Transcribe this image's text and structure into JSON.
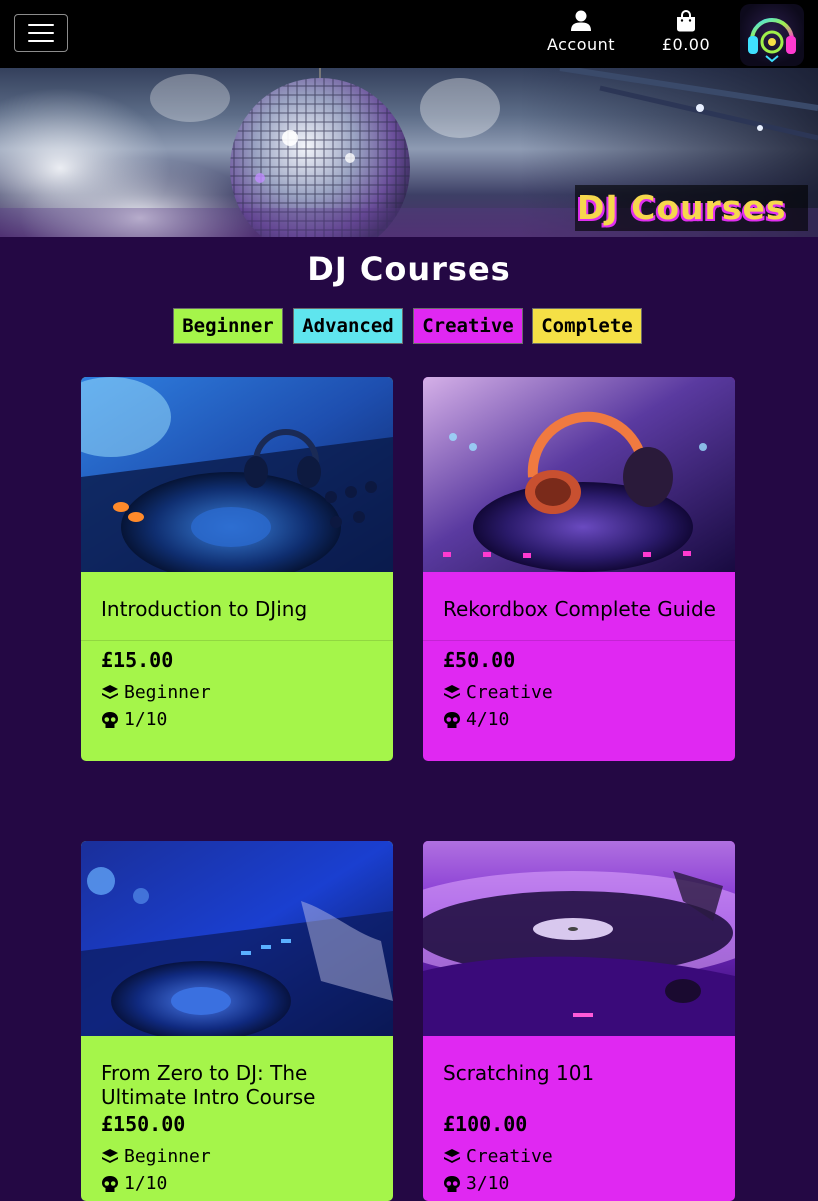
{
  "nav": {
    "menu_label": "Menu",
    "account_label": "Account",
    "basket_total": "£0.00",
    "logo": "headphones-logo"
  },
  "hero": {
    "title": "DJ Courses"
  },
  "page": {
    "title": "DJ Courses"
  },
  "filters": [
    {
      "label": "Beginner",
      "color": "#a5f54a"
    },
    {
      "label": "Advanced",
      "color": "#5fe5ee"
    },
    {
      "label": "Creative",
      "color": "#e028f2"
    },
    {
      "label": "Complete",
      "color": "#f5e046"
    }
  ],
  "courses": [
    {
      "title": "Introduction to DJing",
      "price": "£15.00",
      "category": "Beginner",
      "difficulty": "1/10",
      "image": "blue-dj-deck-with-headphones"
    },
    {
      "title": "Rekordbox Complete Guide",
      "price": "£50.00",
      "category": "Creative",
      "difficulty": "4/10",
      "image": "purple-dj-controller-with-orange-headphones"
    },
    {
      "title": "From Zero to DJ: The Ultimate Intro Course",
      "price": "£150.00",
      "category": "Beginner",
      "difficulty": "1/10",
      "image": "blue-dj-controller-hands"
    },
    {
      "title": "Scratching 101",
      "price": "£100.00",
      "category": "Creative",
      "difficulty": "3/10",
      "image": "purple-turntable"
    }
  ],
  "colors": {
    "background": "#240844",
    "beginner": "#a5f54a",
    "creative": "#e028f2",
    "title_yellow": "#f6d84d"
  }
}
